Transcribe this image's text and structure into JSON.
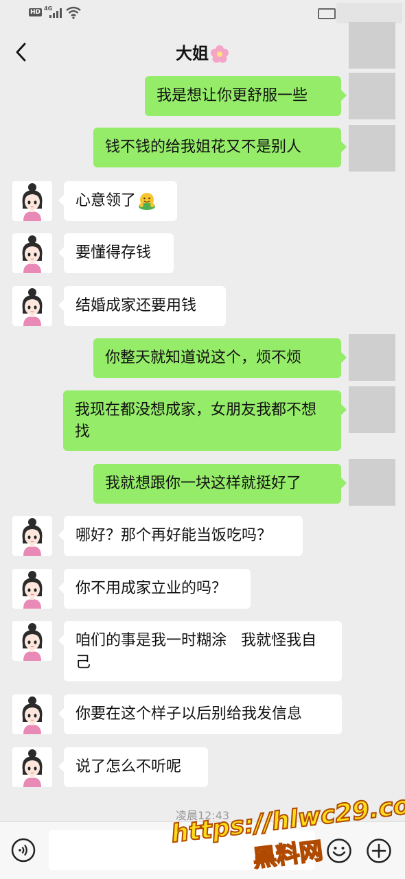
{
  "status_bar": {
    "hd": "HD",
    "network": "4G"
  },
  "header": {
    "title": "大姐"
  },
  "messages": [
    {
      "side": "out",
      "text": "我是想让你更舒服一些"
    },
    {
      "side": "out",
      "text": "钱不钱的给我姐花又不是别人"
    },
    {
      "side": "in",
      "text": "心意领了"
    },
    {
      "side": "in",
      "text": "要懂得存钱"
    },
    {
      "side": "in",
      "text": "结婚成家还要用钱"
    },
    {
      "side": "out",
      "text": "你整天就知道说这个，烦不烦"
    },
    {
      "side": "out",
      "text": "我现在都没想成家，女朋友我都不想找"
    },
    {
      "side": "out",
      "text": "我就想跟你一块这样就挺好了"
    },
    {
      "side": "in",
      "text": "哪好？那个再好能当饭吃吗？"
    },
    {
      "side": "in",
      "text": "你不用成家立业的吗？"
    },
    {
      "side": "in",
      "text": "咱们的事是我一时糊涂   我就怪我自己"
    },
    {
      "side": "in",
      "text": "你要在这个样子以后别给我发信息"
    },
    {
      "side": "in",
      "text": "说了怎么不听呢"
    }
  ],
  "timestamp": "凌晨12:43",
  "watermark": {
    "line1": "https://hlwc29.com",
    "line2": "黑料网"
  },
  "icons": [
    "back-icon",
    "voice-icon",
    "emoji-icon",
    "plus-icon",
    "flower-emoji",
    "hug-emoji"
  ]
}
